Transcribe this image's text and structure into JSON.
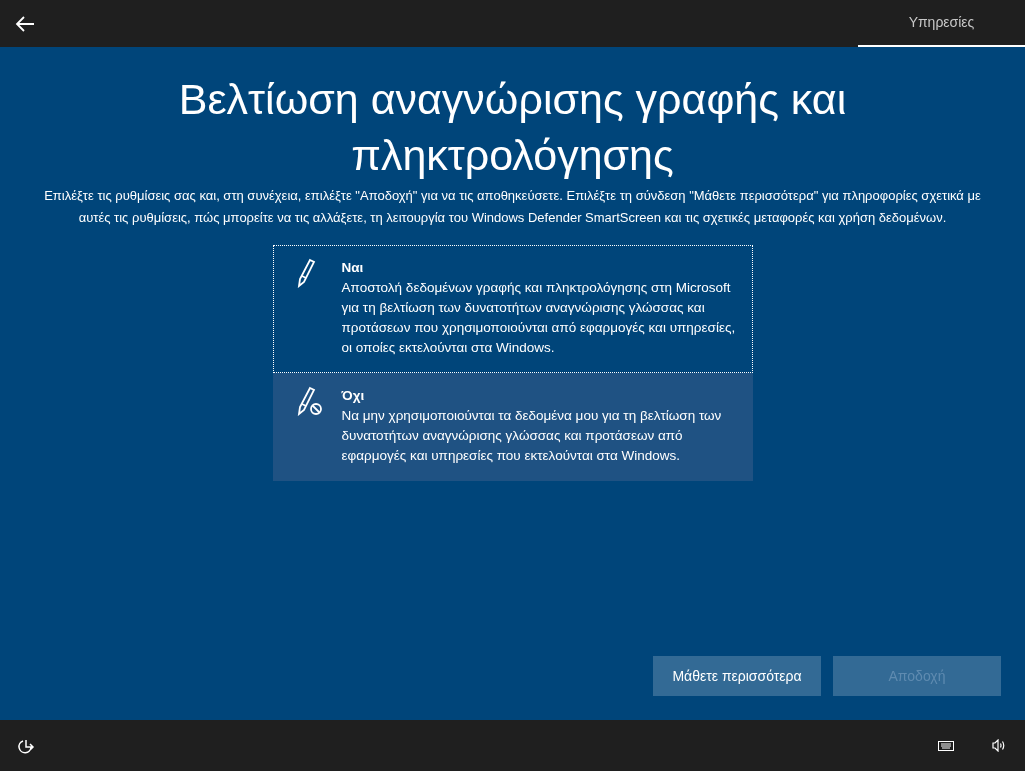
{
  "tabs": [
    {
      "label": "Υπηρεσίες",
      "selected": true
    }
  ],
  "title": "Βελτίωση αναγνώρισης γραφής και πληκτρολόγησης",
  "description": "Επιλέξτε τις ρυθμίσεις σας και, στη συνέχεια, επιλέξτε \"Αποδοχή\" για να τις αποθηκεύσετε. Επιλέξτε τη σύνδεση \"Μάθετε περισσότερα\" για πληροφορίες σχετικά με αυτές τις ρυθμίσεις, πώς μπορείτε να τις αλλάξετε, τη λειτουργία του Windows Defender SmartScreen και τις σχετικές μεταφορές και χρήση δεδομένων.",
  "options": [
    {
      "kind": "yes",
      "label": "Ναι",
      "text": "Αποστολή δεδομένων γραφής και πληκτρολόγησης στη Microsoft για τη βελτίωση των δυνατοτήτων αναγνώρισης γλώσσας και προτάσεων που χρησιμοποιούνται από εφαρμογές και υπηρεσίες, οι οποίες εκτελούνται στα Windows.",
      "selected": false,
      "focused": true,
      "hovered": false
    },
    {
      "kind": "no",
      "label": "Όχι",
      "text": "Να μην χρησιμοποιούνται τα δεδομένα μου για τη βελτίωση των δυνατοτήτων αναγνώρισης γλώσσας και προτάσεων από εφαρμογές και υπηρεσίες που εκτελούνται στα Windows.",
      "selected": false,
      "focused": false,
      "hovered": true
    }
  ],
  "buttons": [
    {
      "label": "Μάθετε περισσότερα",
      "disabled": false
    },
    {
      "label": "Αποδοχή",
      "disabled": true
    }
  ]
}
